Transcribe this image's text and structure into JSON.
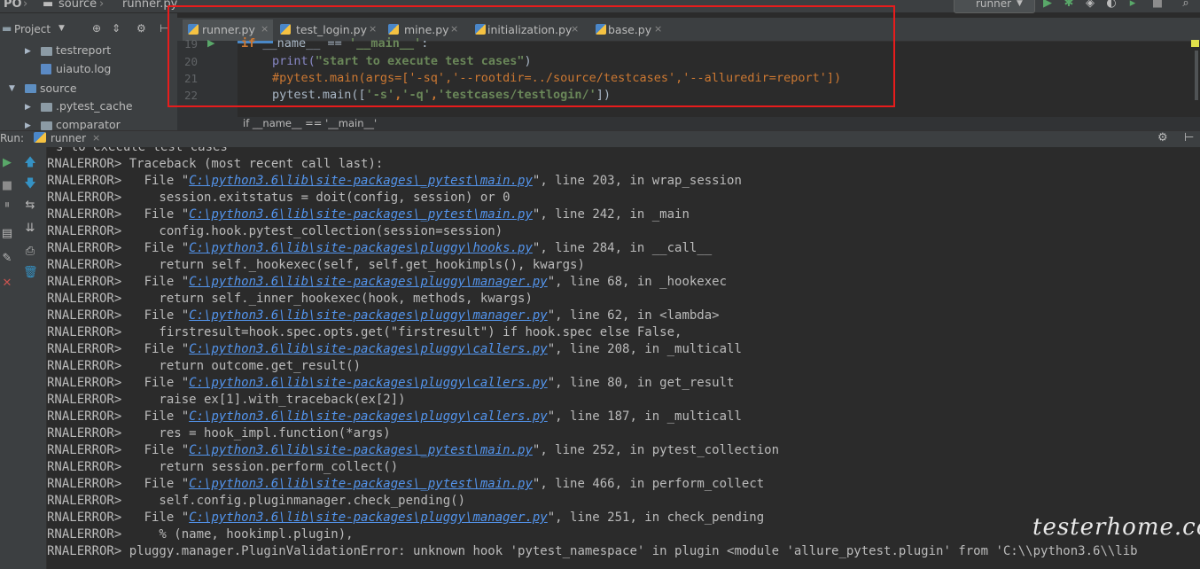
{
  "navbar": {
    "crumbs": [
      "PO",
      "source",
      "runner.py"
    ],
    "run_config": "runner"
  },
  "project": {
    "header": "Project",
    "items": [
      {
        "label": "testreport",
        "type": "folder"
      },
      {
        "label": "uiauto.log",
        "type": "file"
      },
      {
        "label": "source",
        "type": "folder"
      },
      {
        "label": ".pytest_cache",
        "type": "folder"
      },
      {
        "label": "comparator",
        "type": "folder"
      }
    ]
  },
  "editor": {
    "tabs": [
      "runner.py",
      "test_login.py",
      "mine.py",
      "initialization.py",
      "base.py"
    ],
    "lines": [
      {
        "num": "19"
      },
      {
        "num": "20"
      },
      {
        "num": "21"
      },
      {
        "num": "22"
      }
    ],
    "code": {
      "l19_kw": "if",
      "l19_name": " __name__ == ",
      "l19_str": "'__main__'",
      "l19_end": ":",
      "l20_fn": "print(",
      "l20_str": "\"start to execute test cases\"",
      "l20_end": ")",
      "l21": "#pytest.main(args=['-sq','--rootdir=../source/testcases','--alluredir=report'])",
      "l22_a": "pytest.main([",
      "l22_s1": "'-s'",
      "l22_c1": ",",
      "l22_s2": "'-q'",
      "l22_c2": ",",
      "l22_s3": "'testcases/testlogin/'",
      "l22_end": "])"
    },
    "breadcrumb": "if __name__ == '__main__'"
  },
  "run": {
    "label": "Run:",
    "tab": "runner",
    "partial_first": "s to execute test cases",
    "lines": [
      {
        "prefix": "RNALERROR> ",
        "text": "Traceback (most recent call last):"
      },
      {
        "prefix": "RNALERROR> ",
        "pre": "  File \"",
        "link": "C:\\python3.6\\lib\\site-packages\\_pytest\\main.py",
        "post": "\", line 203, in wrap_session"
      },
      {
        "prefix": "RNALERROR> ",
        "text": "    session.exitstatus = doit(config, session) or 0"
      },
      {
        "prefix": "RNALERROR> ",
        "pre": "  File \"",
        "link": "C:\\python3.6\\lib\\site-packages\\_pytest\\main.py",
        "post": "\", line 242, in _main"
      },
      {
        "prefix": "RNALERROR> ",
        "text": "    config.hook.pytest_collection(session=session)"
      },
      {
        "prefix": "RNALERROR> ",
        "pre": "  File \"",
        "link": "C:\\python3.6\\lib\\site-packages\\pluggy\\hooks.py",
        "post": "\", line 284, in __call__"
      },
      {
        "prefix": "RNALERROR> ",
        "text": "    return self._hookexec(self, self.get_hookimpls(), kwargs)"
      },
      {
        "prefix": "RNALERROR> ",
        "pre": "  File \"",
        "link": "C:\\python3.6\\lib\\site-packages\\pluggy\\manager.py",
        "post": "\", line 68, in _hookexec"
      },
      {
        "prefix": "RNALERROR> ",
        "text": "    return self._inner_hookexec(hook, methods, kwargs)"
      },
      {
        "prefix": "RNALERROR> ",
        "pre": "  File \"",
        "link": "C:\\python3.6\\lib\\site-packages\\pluggy\\manager.py",
        "post": "\", line 62, in <lambda>"
      },
      {
        "prefix": "RNALERROR> ",
        "text": "    firstresult=hook.spec.opts.get(\"firstresult\") if hook.spec else False,"
      },
      {
        "prefix": "RNALERROR> ",
        "pre": "  File \"",
        "link": "C:\\python3.6\\lib\\site-packages\\pluggy\\callers.py",
        "post": "\", line 208, in _multicall"
      },
      {
        "prefix": "RNALERROR> ",
        "text": "    return outcome.get_result()"
      },
      {
        "prefix": "RNALERROR> ",
        "pre": "  File \"",
        "link": "C:\\python3.6\\lib\\site-packages\\pluggy\\callers.py",
        "post": "\", line 80, in get_result"
      },
      {
        "prefix": "RNALERROR> ",
        "text": "    raise ex[1].with_traceback(ex[2])"
      },
      {
        "prefix": "RNALERROR> ",
        "pre": "  File \"",
        "link": "C:\\python3.6\\lib\\site-packages\\pluggy\\callers.py",
        "post": "\", line 187, in _multicall"
      },
      {
        "prefix": "RNALERROR> ",
        "text": "    res = hook_impl.function(*args)"
      },
      {
        "prefix": "RNALERROR> ",
        "pre": "  File \"",
        "link": "C:\\python3.6\\lib\\site-packages\\_pytest\\main.py",
        "post": "\", line 252, in pytest_collection"
      },
      {
        "prefix": "RNALERROR> ",
        "text": "    return session.perform_collect()"
      },
      {
        "prefix": "RNALERROR> ",
        "pre": "  File \"",
        "link": "C:\\python3.6\\lib\\site-packages\\_pytest\\main.py",
        "post": "\", line 466, in perform_collect"
      },
      {
        "prefix": "RNALERROR> ",
        "text": "    self.config.pluginmanager.check_pending()"
      },
      {
        "prefix": "RNALERROR> ",
        "pre": "  File \"",
        "link": "C:\\python3.6\\lib\\site-packages\\pluggy\\manager.py",
        "post": "\", line 251, in check_pending"
      },
      {
        "prefix": "RNALERROR> ",
        "text": "    % (name, hookimpl.plugin),"
      },
      {
        "prefix": "RNALERROR> ",
        "text": "pluggy.manager.PluginValidationError: unknown hook 'pytest_namespace' in plugin <module 'allure_pytest.plugin' from 'C:\\\\python3.6\\\\lib"
      }
    ]
  },
  "watermark": "testerhome.com",
  "colors": {
    "highlight": "#e81c1c",
    "link": "#5394ec",
    "keyword": "#cc7832",
    "string": "#6a8759"
  }
}
